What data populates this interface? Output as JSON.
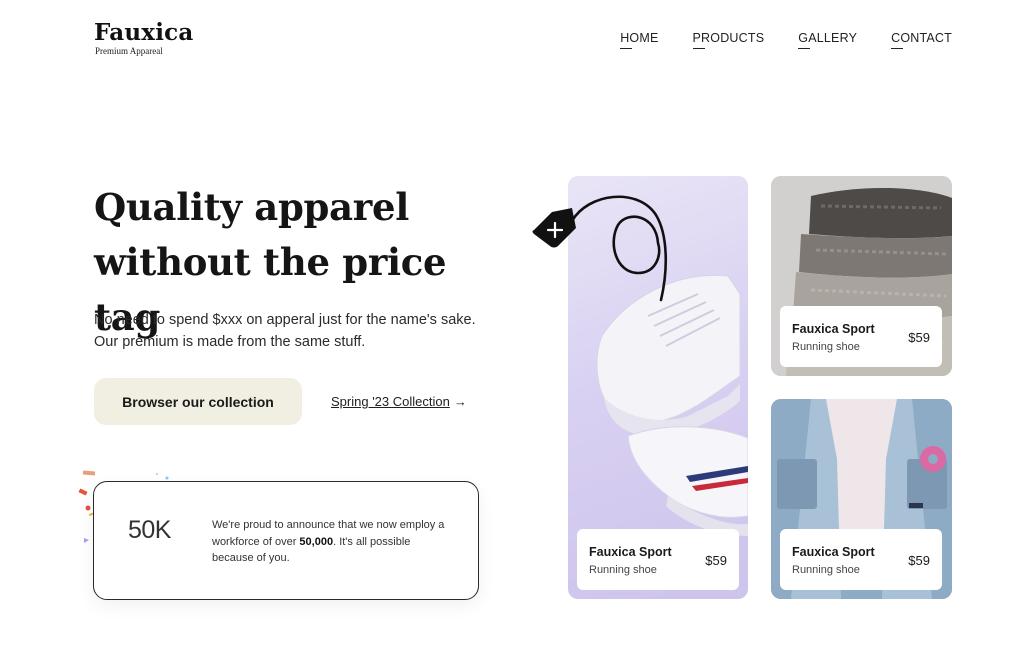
{
  "brand": {
    "name": "Fauxica",
    "tagline": "Premium Appareal"
  },
  "nav": {
    "items": [
      {
        "label": "HOME"
      },
      {
        "label": "PRODUCTS"
      },
      {
        "label": "GALLERY"
      },
      {
        "label": "CONTACT"
      }
    ]
  },
  "hero": {
    "title_line1": "Quality apparel",
    "title_line2": "without the price tag",
    "subtitle": "No need to spend $xxx on apperal just for the name's sake. Our premium is made from the same stuff.",
    "cta_label": "Browser our collection",
    "secondary_link": "Spring '23 Collection",
    "secondary_arrow": "→"
  },
  "stat": {
    "number": "50K",
    "text_before": "We're proud to announce that we now employ a workforce of over ",
    "text_bold": "50,000",
    "text_after": ". It's all possible because of you."
  },
  "products": [
    {
      "name": "Fauxica Sport",
      "type": "Running shoe",
      "price": "$59",
      "image": "white sneakers"
    },
    {
      "name": "Fauxica Sport",
      "type": "Running shoe",
      "price": "$59",
      "image": "folded knit sweaters"
    },
    {
      "name": "Fauxica Sport",
      "type": "Running shoe",
      "price": "$59",
      "image": "denim jacket"
    }
  ],
  "icons": {
    "tag": "price-tag-icon",
    "arrow": "arrow-right-icon"
  },
  "colors": {
    "cta_bg": "#f1efe2",
    "text": "#1b1b1b",
    "shoe_bg": "#d9d1f2"
  }
}
